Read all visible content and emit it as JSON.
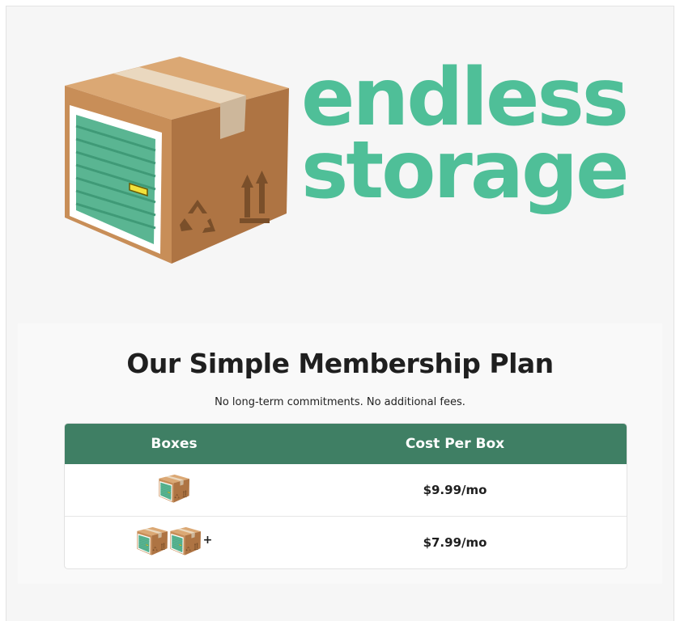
{
  "brand": {
    "line1": "endless",
    "line2": "storage",
    "color": "#4fbf98"
  },
  "plan": {
    "title": "Our Simple Membership Plan",
    "subtitle": "No long-term commitments. No additional fees.",
    "header_color": "#3f7f64",
    "columns": [
      "Boxes",
      "Cost Per Box"
    ],
    "rows": [
      {
        "boxes_icon_count": 1,
        "plus": "",
        "price": "$9.99/mo"
      },
      {
        "boxes_icon_count": 2,
        "plus": "+",
        "price": "$7.99/mo"
      }
    ]
  },
  "icons": {
    "logo": "storage-box-icon",
    "row_box": "storage-box-icon"
  }
}
